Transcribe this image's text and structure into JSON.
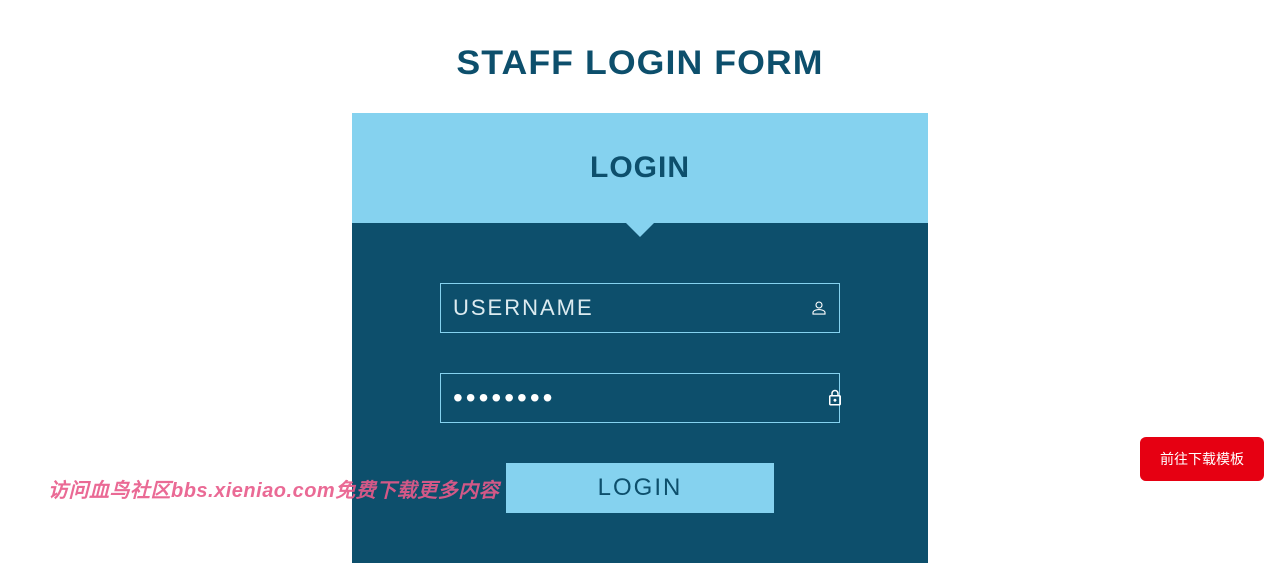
{
  "page": {
    "title": "STAFF LOGIN FORM"
  },
  "card": {
    "header": "LOGIN",
    "username": {
      "placeholder": "USERNAME",
      "value": ""
    },
    "password": {
      "placeholder": "",
      "value": "••••••••"
    },
    "submit_label": "LOGIN"
  },
  "floating": {
    "download_button": "前往下载模板",
    "watermark": "访问血鸟社区bbs.xieniao.com免费下载更多内容"
  }
}
